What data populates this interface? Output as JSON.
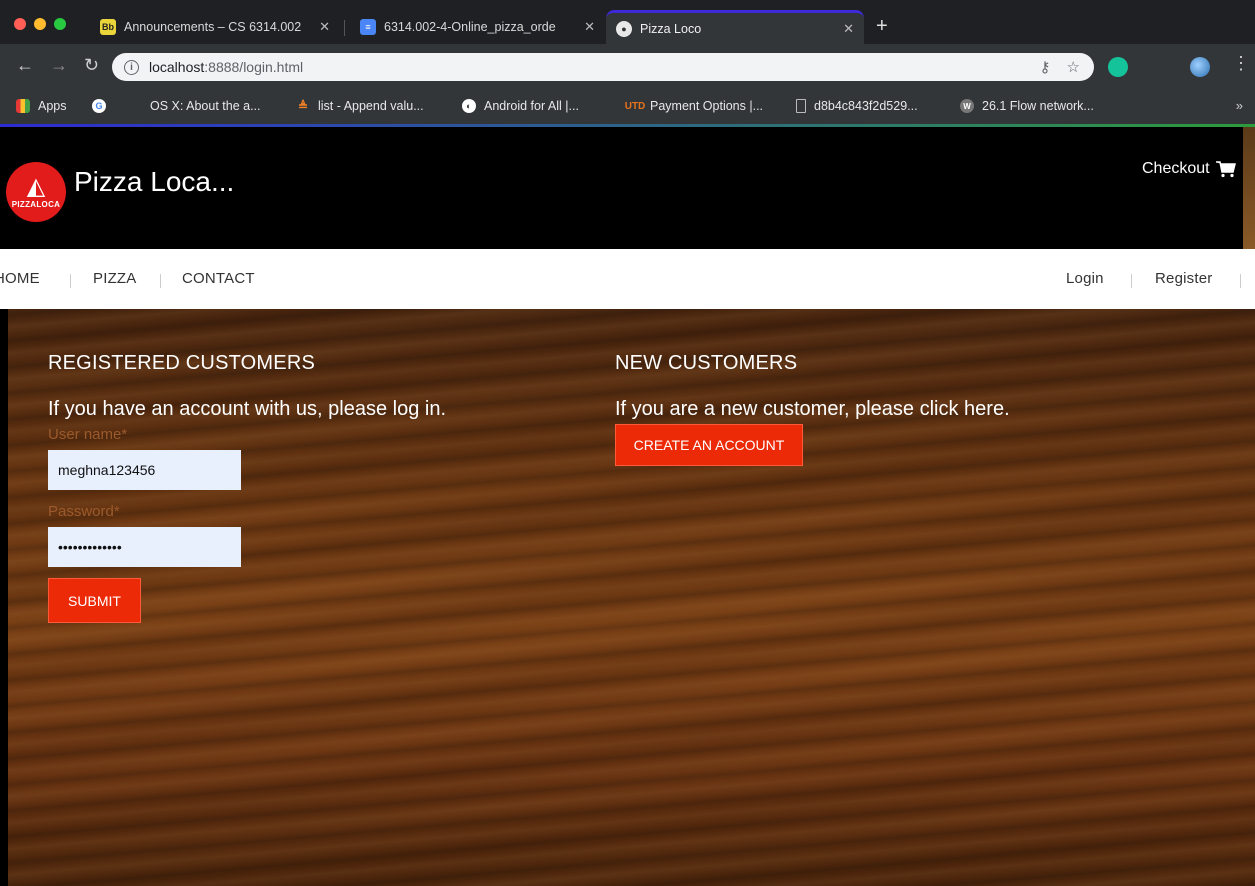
{
  "browser": {
    "tabs": [
      {
        "title": "Announcements – CS 6314.002",
        "favicon": "Bb",
        "active": false
      },
      {
        "title": "6314.002-4-Online_pizza_orde",
        "favicon": "doc",
        "active": false
      },
      {
        "title": "Pizza Loco",
        "favicon": "globe",
        "active": true
      }
    ],
    "new_tab": "+",
    "address": {
      "host": "localhost",
      "path": ":8888/login.html"
    },
    "bookmarks": [
      {
        "label": "Apps",
        "icon": "apps-grid-icon"
      },
      {
        "label": "",
        "icon": "google-icon"
      },
      {
        "label": "OS X: About the a...",
        "icon": "apple-icon"
      },
      {
        "label": "list - Append valu...",
        "icon": "stackoverflow-icon"
      },
      {
        "label": "Android for All |...",
        "icon": "android-icon"
      },
      {
        "label": "Payment Options |...",
        "icon": "utd-icon"
      },
      {
        "label": "d8b4c843f2d529...",
        "icon": "file-icon"
      },
      {
        "label": "26.1 Flow network...",
        "icon": "w-icon"
      }
    ],
    "overflow": "»"
  },
  "site": {
    "title": "Pizza Loca...",
    "logo_text": "PIZZALOCA",
    "checkout": "Checkout"
  },
  "nav": {
    "left": [
      "HOME",
      "PIZZA",
      "CONTACT"
    ],
    "right": [
      "Login",
      "Register"
    ]
  },
  "registered": {
    "heading": "REGISTERED CUSTOMERS",
    "subtitle": "If you have an account with us, please log in.",
    "username_label": "User name*",
    "username_value": "meghna123456",
    "password_label": "Password*",
    "password_value": "•••••••••••••",
    "submit": "SUBMIT"
  },
  "new_customer": {
    "heading": "NEW CUSTOMERS",
    "subtitle": "If you are a new customer, please click here.",
    "create": "CREATE AN ACCOUNT"
  }
}
